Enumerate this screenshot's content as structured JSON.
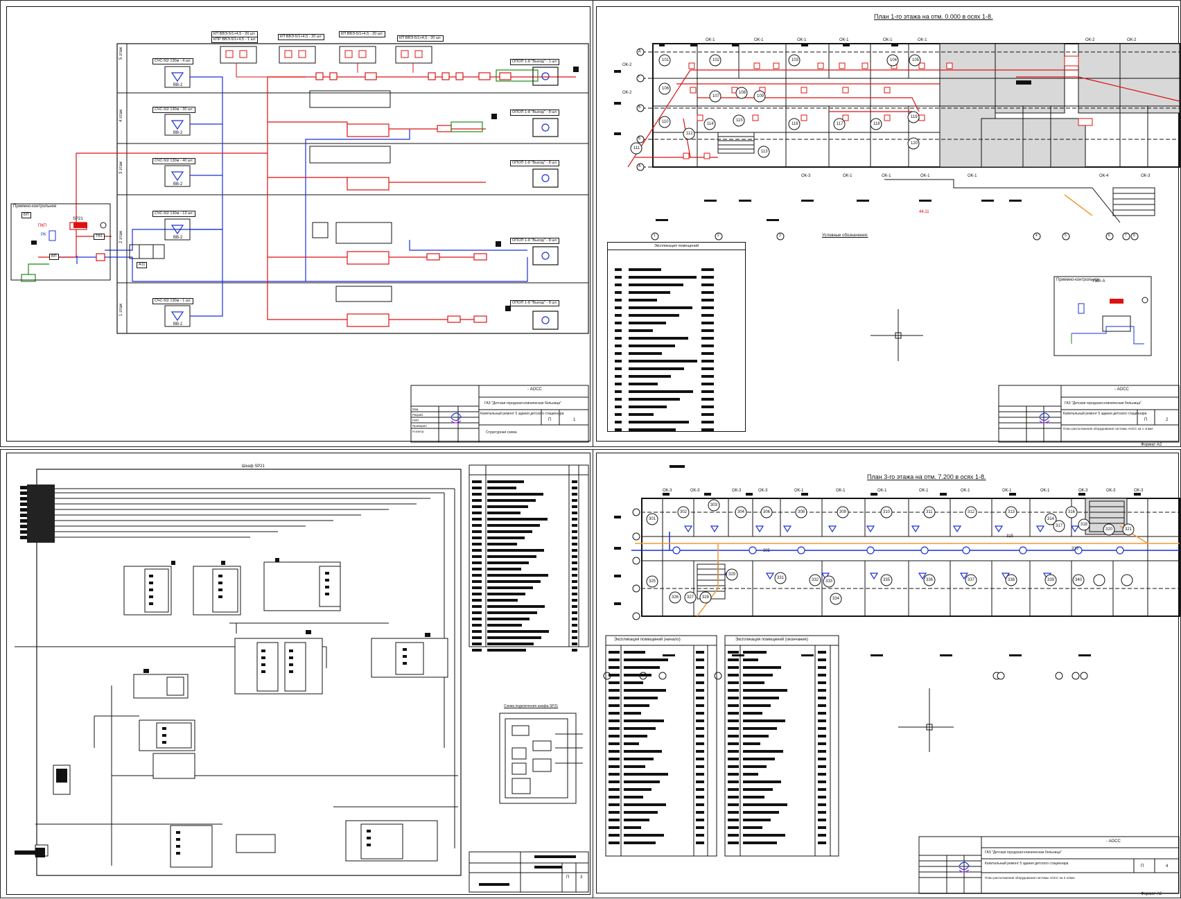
{
  "sheet1": {
    "floors": [
      "5 этаж",
      "4 этаж",
      "3 этаж",
      "2 этаж",
      "1 этаж"
    ],
    "header_labels": [
      "КП ВВЭ-5/1+4,5 - 20 шт.",
      "КПР ВВЭ-5/1+4,5 - 1 шт.",
      "КП ВВЭ-5/1+4,5 - 20 шт.",
      "КП ВВЭ-5/1+4,5 - 20 шт.",
      "КП ВВЭ-5/1+4,5 - 20 шт."
    ],
    "speakers": [
      "ВВ-2",
      "ВВ-2",
      "ВВ-2",
      "ВВ-2",
      "ВВ-2"
    ],
    "speaker_labels": [
      "СЧС-50/ 130м - 4 шт.",
      "СЧС-50/ 130м - 30 шт.",
      "СЧС-50/ 130м - 40 шт.",
      "СЧС-50/ 130м - 13 шт.",
      "СЧС-50/ 130м - 1 шт."
    ],
    "sirens": [
      "ОПОП 1-8 \"Выход\" - 1 шт.",
      "ОПОП 1-8 \"Выход\" - 8 шт.",
      "ОПОП 1-8 \"Выход\" - 8 шт.",
      "ОПОП 1-8 \"Выход\" - 8 шт.",
      "ОПОП 1-8 \"Выход\" - 8 шт."
    ],
    "device_block_title": "Приемно-контрольное",
    "device_labels": [
      "ПКП",
      "SP21",
      "ТВ1",
      "РК",
      "ВП",
      "БП",
      "А11"
    ],
    "stamp": {
      "code": "- АОСС",
      "org": "ГАЗ \"Детская городская клиническая больница\"",
      "title": "Капитальный ремонт 5 здания детского стационара",
      "subtitle": "Структурная схема",
      "stage": "П",
      "sheet": "1",
      "sheets": "",
      "rows": [
        "Изм.",
        "Разраб.",
        "ГИП",
        "Проверил",
        "Н.контр."
      ]
    }
  },
  "sheet2": {
    "title": "План 1-го этажа на отм. 0.000 в осях 1-8.",
    "rooms": [
      "101",
      "102",
      "103",
      "104",
      "105",
      "106",
      "107",
      "108",
      "109",
      "110",
      "111",
      "112",
      "113",
      "114",
      "115",
      "116",
      "117",
      "118",
      "119",
      "120"
    ],
    "window_labels": [
      "ОК-1",
      "ОК-1",
      "ОК-1",
      "ОК-1",
      "ОК-1",
      "ОК-1",
      "ОК-2",
      "ОК-2",
      "ОК-2",
      "ОК-2",
      "ОК-3",
      "ОК-1",
      "ОК-1",
      "ОК-1",
      "ОК-1",
      "ОК-4",
      "ОК-3"
    ],
    "axes_rows": [
      "Д",
      "Г",
      "В",
      "Б",
      "А"
    ],
    "axes_cols": [
      "1",
      "2",
      "3",
      "4",
      "5",
      "6",
      "7",
      "8"
    ],
    "legend_caption": "Условные обозначения:",
    "explication_title": "Экспликация помещений",
    "device_block_title": "Приемно-контрольное",
    "device_block_sub": "Узел А",
    "dim": "44,11",
    "stamp": {
      "code": "- АОСС",
      "org": "ГАЗ \"Детская городская клиническая больница\"",
      "title": "Капитальный ремонт 5 здания детского стационара",
      "subtitle": "План расположения оборудования системы АОСС на 1 этаже",
      "stage": "П",
      "sheet": "2",
      "format": "Формат А2"
    }
  },
  "sheet3": {
    "title": "Шкаф SP21",
    "table_rows": 28,
    "scheme_caption": "Схема подключения шкафа SP21",
    "stamp": {
      "stage": "П",
      "sheet": "3"
    }
  },
  "sheet4": {
    "title": "План 3-го этажа на отм. 7.200 в осях 1-8.",
    "rooms": [
      "301",
      "302",
      "303",
      "304",
      "305",
      "306",
      "308",
      "309",
      "310",
      "311",
      "312",
      "313",
      "314",
      "315",
      "316",
      "317",
      "318",
      "319",
      "320",
      "321",
      "325",
      "326",
      "327",
      "328",
      "329",
      "331",
      "332",
      "333",
      "334",
      "335",
      "336",
      "337",
      "338",
      "339",
      "340"
    ],
    "window_labels": [
      "ОК-3",
      "ОК-3",
      "ОК-3",
      "ОК-3",
      "ОК-1",
      "ОК-1",
      "ОК-1",
      "ОК-1",
      "ОК-1",
      "ОК-1",
      "ОК-1",
      "ОК-3",
      "ОК-3",
      "ОК-3"
    ],
    "explication_left": "Экспликация помещений (начало)",
    "explication_right": "Экспликация помещений (окончание)",
    "stamp": {
      "code": "- АОСС",
      "org": "ГАЗ \"Детская городская клиническая больница\"",
      "title": "Капитальный ремонт 5 здания детского стационара",
      "subtitle": "План расположения оборудования системы АОСС на 3 этаже",
      "stage": "П",
      "sheet": "4",
      "format": "Формат А2"
    }
  },
  "colors": {
    "red": "#dd1111",
    "blue": "#1a2fd6",
    "green": "#1a8a1a",
    "grey": "#d8d8d8",
    "orange": "#f09a30"
  }
}
